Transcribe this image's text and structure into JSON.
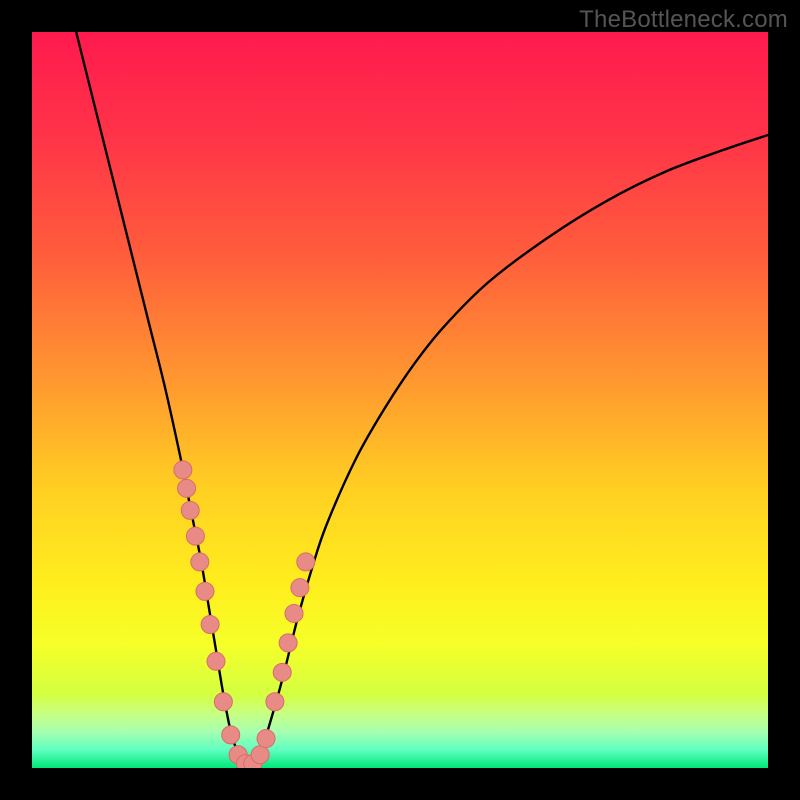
{
  "watermark": "TheBottleneck.com",
  "colors": {
    "frame": "#000000",
    "gradient_stops": [
      {
        "offset": 0.0,
        "color": "#ff1a4e"
      },
      {
        "offset": 0.14,
        "color": "#ff3348"
      },
      {
        "offset": 0.3,
        "color": "#ff5c3c"
      },
      {
        "offset": 0.48,
        "color": "#ff9a2f"
      },
      {
        "offset": 0.62,
        "color": "#ffcf22"
      },
      {
        "offset": 0.75,
        "color": "#ffee1e"
      },
      {
        "offset": 0.83,
        "color": "#f6ff28"
      },
      {
        "offset": 0.9,
        "color": "#d4ff40"
      },
      {
        "offset": 0.925,
        "color": "#c8ff80"
      },
      {
        "offset": 0.95,
        "color": "#a8ffb0"
      },
      {
        "offset": 0.975,
        "color": "#60ffc0"
      },
      {
        "offset": 1.0,
        "color": "#00e878"
      }
    ],
    "curve": "#000000",
    "point_fill": "#e88b87",
    "point_stroke": "#da6b66"
  },
  "chart_data": {
    "type": "line",
    "title": "",
    "xlabel": "",
    "ylabel": "",
    "xlim": [
      0,
      100
    ],
    "ylim": [
      0,
      100
    ],
    "series": [
      {
        "name": "bottleneck-curve",
        "x": [
          6,
          8,
          10,
          12,
          14,
          16,
          18,
          20,
          21,
          22,
          23,
          24,
          25,
          26,
          27,
          28,
          29,
          30,
          31,
          32,
          34,
          36,
          38,
          40,
          44,
          48,
          52,
          56,
          62,
          70,
          78,
          86,
          94,
          100
        ],
        "y": [
          100,
          92,
          84,
          76,
          68,
          60,
          52,
          43,
          38,
          33,
          28,
          22,
          16,
          10,
          5,
          2,
          0.5,
          0.5,
          2,
          5,
          12,
          20,
          27,
          33,
          42,
          49,
          55,
          60,
          66,
          72,
          77,
          81,
          84,
          86
        ]
      }
    ],
    "points": {
      "name": "highlighted-samples",
      "x": [
        20.5,
        21.0,
        21.5,
        22.2,
        22.8,
        23.5,
        24.2,
        25.0,
        26.0,
        27.0,
        28.0,
        29.0,
        30.0,
        31.0,
        31.8,
        33.0,
        34.0,
        34.8,
        35.6,
        36.4,
        37.2
      ],
      "y": [
        40.5,
        38.0,
        35.0,
        31.5,
        28.0,
        24.0,
        19.5,
        14.5,
        9.0,
        4.5,
        1.8,
        0.6,
        0.6,
        1.8,
        4.0,
        9.0,
        13.0,
        17.0,
        21.0,
        24.5,
        28.0
      ]
    }
  }
}
